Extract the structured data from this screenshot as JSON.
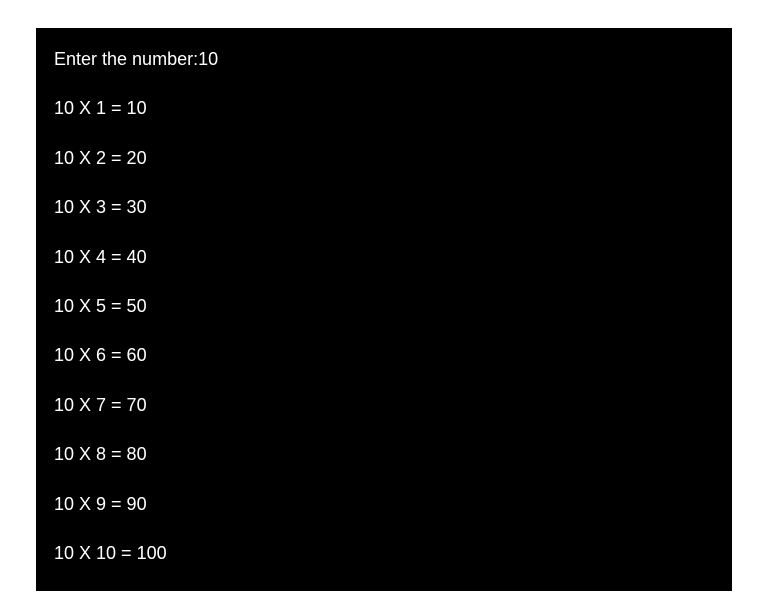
{
  "prompt": {
    "label": "Enter the number:",
    "value": "10"
  },
  "lines": {
    "0": "10 X 1 = 10",
    "1": "10 X 2 = 20",
    "2": "10 X 3 = 30",
    "3": "10 X 4 = 40",
    "4": "10 X 5 = 50",
    "5": "10 X 6 = 60",
    "6": "10 X 7 = 70",
    "7": "10 X 8 = 80",
    "8": "10 X 9 = 90",
    "9": "10 X 10 = 100"
  }
}
